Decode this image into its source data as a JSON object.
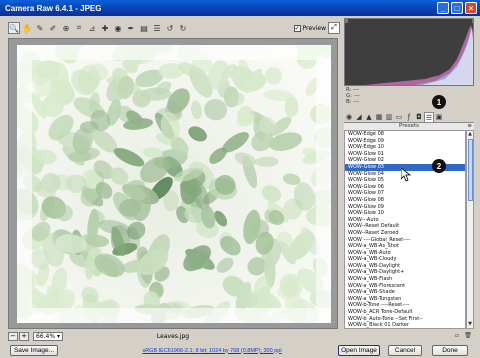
{
  "window": {
    "title": "Camera Raw 6.4.1  -  JPEG",
    "controls": [
      "minimize",
      "maximize",
      "close"
    ]
  },
  "toolbar": {
    "tools": [
      "zoom-icon",
      "hand-icon",
      "white-balance-icon",
      "color-sampler-icon",
      "target-adjust-icon",
      "crop-icon",
      "straighten-icon",
      "spot-removal-icon",
      "red-eye-icon",
      "adjustment-brush-icon",
      "graduated-filter-icon",
      "preferences-icon",
      "rotate-ccw-icon",
      "rotate-cw-icon"
    ],
    "preview_label": "Preview",
    "preview_checked": true
  },
  "histogram": {
    "r_label": "R:",
    "r_value": "---",
    "g_label": "G:",
    "g_value": "---",
    "b_label": "B:",
    "b_value": "---"
  },
  "panel": {
    "tabs": [
      "basic",
      "tone-curve",
      "detail",
      "hsl",
      "split-toning",
      "lens",
      "fx",
      "camera-calibration",
      "presets",
      "snapshots"
    ],
    "active_tab_index": 8,
    "title": "Presets"
  },
  "presets": [
    "WOW-Edge 08",
    "WOW-Edge 09",
    "WOW-Edge 10",
    "WOW-Glow 01",
    "WOW-Glow 02",
    "WOW-Glow 03",
    "WOW-Glow 04",
    "WOW-Glow 05",
    "WOW-Glow 06",
    "WOW-Glow 07",
    "WOW-Glow 08",
    "WOW-Glow 09",
    "WOW-Glow 10",
    "WOW---Auto",
    "WOW--Reset Default",
    "WOW--Reset Zeroed",
    "WOW ----Global_Reset----",
    "WOW-a_WB-As_Shot",
    "WOW-a_WB-Auto",
    "WOW-a_WB-Cloudy",
    "WOW-a_WB-Daylight",
    "WOW-a_WB-Daylight+",
    "WOW-a_WB-Flash",
    "WOW-a_WB-Florescent",
    "WOW-a_WB-Shade",
    "WOW-a_WB-Tungsten",
    "WOW-b-Tone ----Reset----",
    "WOW-b_ACR Tone-Default",
    "WOW-b_Auto-Tone --Set First--",
    "WOW-b_Black 01 Darker"
  ],
  "selected_preset_index": 5,
  "status": {
    "zoom": "66.4%",
    "filename": "Leaves.jpg"
  },
  "footer": {
    "save_label": "Save Image...",
    "workflow_label": "sRGB IEC61966-2.1; 8 bit; 1024 by 768 (0.8MP); 300 ppi",
    "open_label": "Open Image",
    "cancel_label": "Cancel",
    "done_label": "Done"
  },
  "callouts": [
    "1",
    "2"
  ]
}
